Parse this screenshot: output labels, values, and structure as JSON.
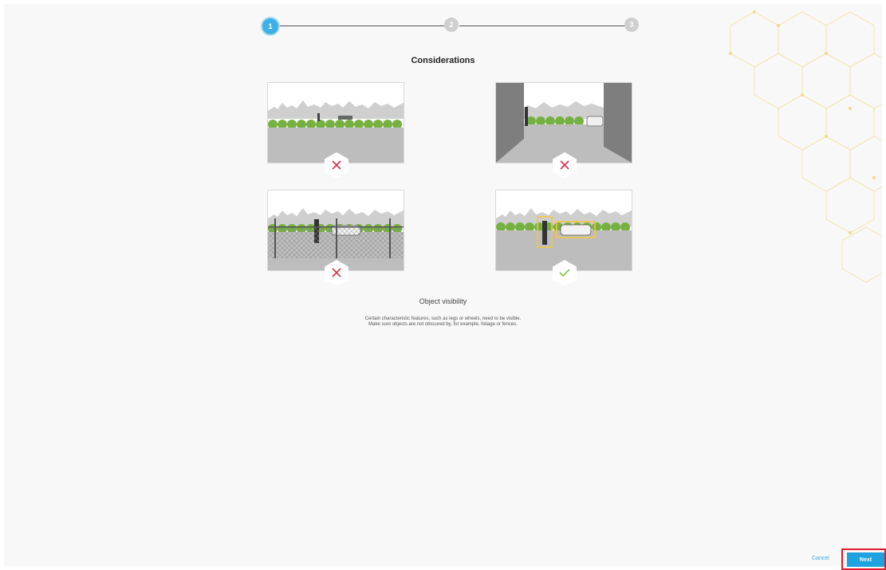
{
  "stepper": {
    "steps": [
      {
        "label": "1",
        "state": "active"
      },
      {
        "label": "2",
        "state": "inactive"
      },
      {
        "label": "3",
        "state": "inactive"
      }
    ]
  },
  "header": {
    "title": "Considerations"
  },
  "scenes": [
    {
      "name": "distant-objects",
      "verdict": "bad"
    },
    {
      "name": "walls-blocking",
      "verdict": "bad"
    },
    {
      "name": "fence-obscuring",
      "verdict": "bad"
    },
    {
      "name": "clear-view-detected",
      "verdict": "good"
    }
  ],
  "content": {
    "caption": "Object visibility",
    "description_line1": "Certain characteristic features, such as legs or wheels, need to be visible.",
    "description_line2": "Make sure objects are not obscured by, for example, foliage or fences."
  },
  "footer": {
    "cancel_label": "Cancel",
    "next_label": "Next"
  },
  "colors": {
    "accent": "#1ea3e0",
    "bad": "#d9304a",
    "good": "#7ac943",
    "highlight": "#f5c542"
  }
}
